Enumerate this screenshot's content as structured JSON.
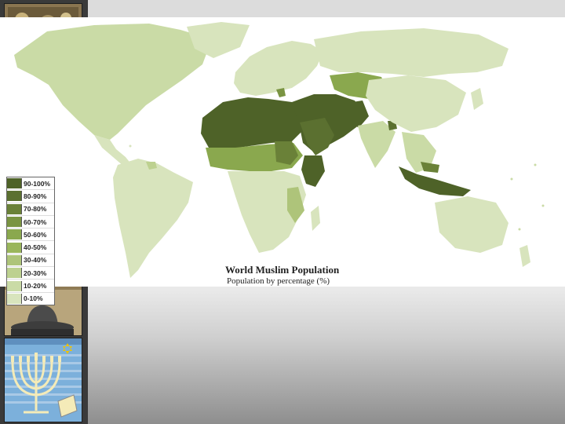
{
  "map": {
    "title": "World Muslim Population",
    "subtitle": "Population by percentage (%)",
    "legend": [
      {
        "label": "90-100%",
        "color": "#4e6228"
      },
      {
        "label": "80-90%",
        "color": "#5b7030"
      },
      {
        "label": "70-80%",
        "color": "#6a8138"
      },
      {
        "label": "60-70%",
        "color": "#7a9442"
      },
      {
        "label": "50-60%",
        "color": "#8aa84e"
      },
      {
        "label": "40-50%",
        "color": "#9ab65c"
      },
      {
        "label": "30-40%",
        "color": "#aec47a"
      },
      {
        "label": "20-30%",
        "color": "#bdd190"
      },
      {
        "label": "10-20%",
        "color": "#cadba6"
      },
      {
        "label": "0-10%",
        "color": "#d8e4bd"
      }
    ]
  }
}
